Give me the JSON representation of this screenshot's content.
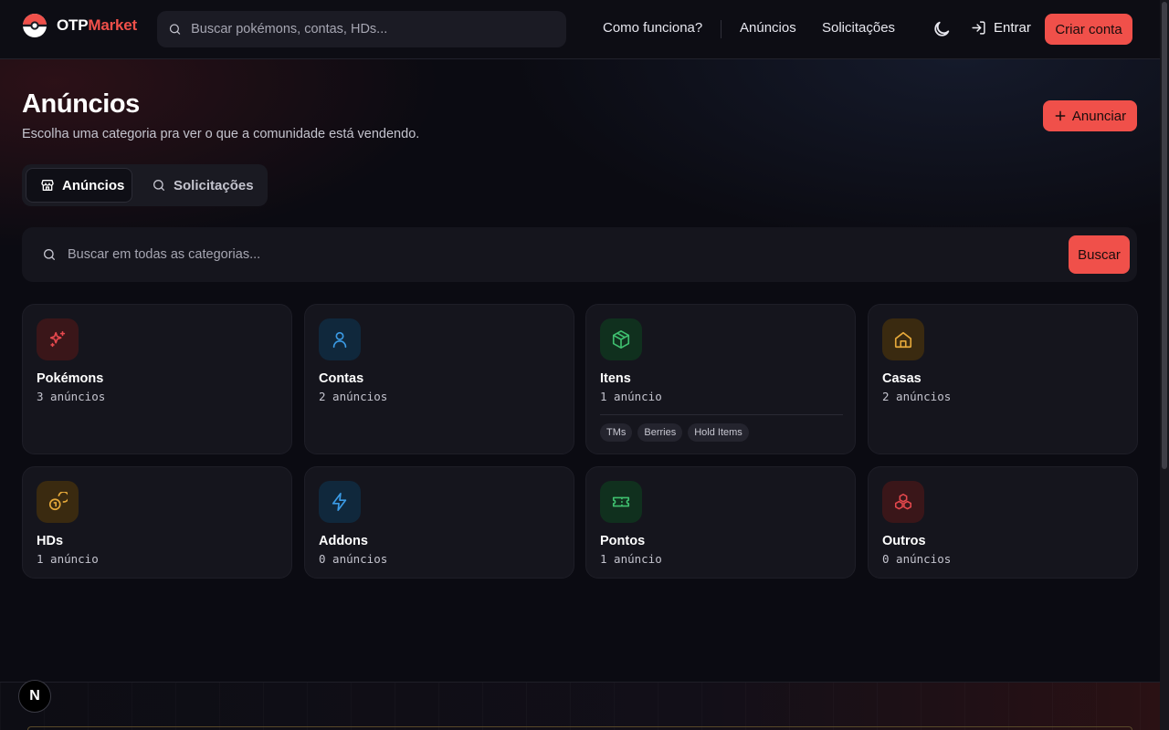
{
  "header": {
    "logo_otp": "OTP",
    "logo_market": "Market",
    "search_placeholder": "Buscar pokémons, contas, HDs...",
    "nav": {
      "how": "Como funciona?",
      "ads": "Anúncios",
      "requests": "Solicitações"
    },
    "login": "Entrar",
    "signup": "Criar conta",
    "icons": {
      "search": "search-icon",
      "theme": "moon-icon",
      "login": "login-icon"
    }
  },
  "main": {
    "title": "Anúncios",
    "subtitle": "Escolha uma categoria pra ver o que a comunidade está vendendo.",
    "announce_button": "Anunciar",
    "tabs": [
      {
        "label": "Anúncios",
        "icon": "store-icon",
        "active": true
      },
      {
        "label": "Solicitações",
        "icon": "search-icon",
        "active": false
      }
    ],
    "search": {
      "placeholder": "Buscar em todas as categorias...",
      "button": "Buscar"
    }
  },
  "categories": [
    {
      "title": "Pokémons",
      "count": "3 anúncios",
      "icon": "sparkles-icon",
      "color": "#e5484d",
      "bg": "#3a1619"
    },
    {
      "title": "Contas",
      "count": "2 anúncios",
      "icon": "user-icon",
      "color": "#3b9be5",
      "bg": "#10283c"
    },
    {
      "title": "Itens",
      "count": "1 anúncio",
      "icon": "box-icon",
      "color": "#3fbf6f",
      "bg": "#10301e",
      "chips": [
        "TMs",
        "Berries",
        "Hold Items"
      ]
    },
    {
      "title": "Casas",
      "count": "2 anúncios",
      "icon": "home-icon",
      "color": "#e5a83a",
      "bg": "#3a2a10"
    },
    {
      "title": "HDs",
      "count": "1 anúncio",
      "icon": "coins-icon",
      "color": "#e5a83a",
      "bg": "#3a2a10"
    },
    {
      "title": "Addons",
      "count": "0 anúncios",
      "icon": "zap-icon",
      "color": "#3b9be5",
      "bg": "#10283c"
    },
    {
      "title": "Pontos",
      "count": "1 anúncio",
      "icon": "ticket-icon",
      "color": "#3fbf6f",
      "bg": "#10301e"
    },
    {
      "title": "Outros",
      "count": "0 anúncios",
      "icon": "boxes-icon",
      "color": "#e5484d",
      "bg": "#3a1619"
    }
  ],
  "footer": {
    "badge": "N"
  },
  "colors": {
    "accent": "#f0504a",
    "background": "#0b0b12",
    "card": "#15151d"
  }
}
